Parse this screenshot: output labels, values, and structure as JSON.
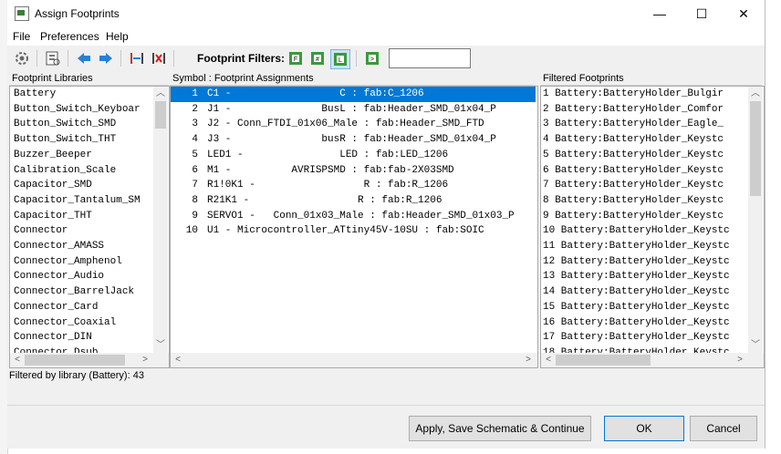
{
  "window": {
    "title": "Assign Footprints",
    "minimize_glyph": "—",
    "maximize_glyph": "☐",
    "close_glyph": "✕"
  },
  "menu": {
    "items": [
      "File",
      "Preferences",
      "Help"
    ]
  },
  "toolbar": {
    "filter_label": "Footprint Filters:",
    "filter_value": ""
  },
  "libraries": {
    "header": "Footprint Libraries",
    "items": [
      "Battery",
      "Button_Switch_Keyboar",
      "Button_Switch_SMD",
      "Button_Switch_THT",
      "Buzzer_Beeper",
      "Calibration_Scale",
      "Capacitor_SMD",
      "Capacitor_Tantalum_SM",
      "Capacitor_THT",
      "Connector",
      "Connector_AMASS",
      "Connector_Amphenol",
      "Connector_Audio",
      "Connector_BarrelJack",
      "Connector_Card",
      "Connector_Coaxial",
      "Connector_DIN",
      "Connector_Dsub"
    ],
    "selected_index": 0
  },
  "assignments": {
    "header": "Symbol : Footprint Assignments",
    "rows": [
      {
        "num": "1",
        "text": "C1 -                  C : fab:C_1206"
      },
      {
        "num": "2",
        "text": "J1 -               BusL : fab:Header_SMD_01x04_P"
      },
      {
        "num": "3",
        "text": "J2 - Conn_FTDI_01x06_Male : fab:Header_SMD_FTD"
      },
      {
        "num": "4",
        "text": "J3 -               busR : fab:Header_SMD_01x04_P"
      },
      {
        "num": "5",
        "text": "LED1 -                LED : fab:LED_1206"
      },
      {
        "num": "6",
        "text": "M1 -          AVRISPSMD : fab:fab-2X03SMD"
      },
      {
        "num": "7",
        "text": "R1!0K1 -                  R : fab:R_1206"
      },
      {
        "num": "8",
        "text": "R21K1 -                  R : fab:R_1206"
      },
      {
        "num": "9",
        "text": "SERVO1 -   Conn_01x03_Male : fab:Header_SMD_01x03_P"
      },
      {
        "num": "10",
        "text": "U1 - Microcontroller_ATtiny45V-10SU : fab:SOIC"
      }
    ],
    "selected_index": 0
  },
  "filtered": {
    "header": "Filtered Footprints",
    "rows": [
      "1 Battery:BatteryHolder_Bulgir",
      "2 Battery:BatteryHolder_Comfor",
      "3 Battery:BatteryHolder_Eagle_",
      "4 Battery:BatteryHolder_Keystc",
      "5 Battery:BatteryHolder_Keystc",
      "6 Battery:BatteryHolder_Keystc",
      "7 Battery:BatteryHolder_Keystc",
      "8 Battery:BatteryHolder_Keystc",
      "9 Battery:BatteryHolder_Keystc",
      "10 Battery:BatteryHolder_Keystc",
      "11 Battery:BatteryHolder_Keystc",
      "12 Battery:BatteryHolder_Keystc",
      "13 Battery:BatteryHolder_Keystc",
      "14 Battery:BatteryHolder_Keystc",
      "15 Battery:BatteryHolder_Keystc",
      "16 Battery:BatteryHolder_Keystc",
      "17 Battery:BatteryHolder_Keystc",
      "18 Battery:BatteryHolder_Keystc"
    ]
  },
  "status": {
    "text": "Filtered by library (Battery): 43"
  },
  "buttons": {
    "apply": "Apply, Save Schematic & Continue",
    "ok": "OK",
    "cancel": "Cancel"
  },
  "colors": {
    "selection": "#0078d7",
    "window_bg": "#f0f0f0"
  }
}
